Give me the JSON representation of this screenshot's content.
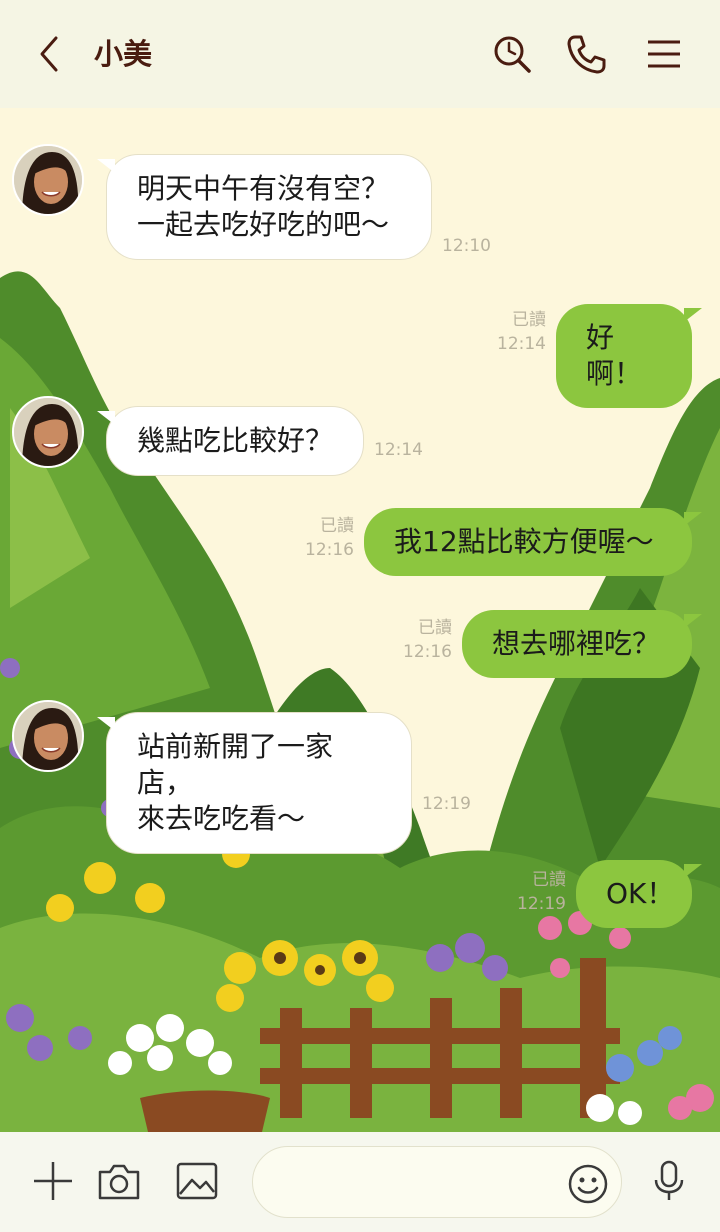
{
  "header": {
    "contact_name": "小美"
  },
  "colors": {
    "header_bg": "#f5f5e4",
    "chat_bg": "#fdf7dc",
    "outgoing_bubble": "#8cc63f",
    "incoming_bubble": "#ffffff",
    "accent_dark": "#4a1c10"
  },
  "icons": {
    "back": "chevron-left-icon",
    "search": "search-icon",
    "call": "phone-icon",
    "menu": "hamburger-menu-icon",
    "plus": "plus-icon",
    "camera": "camera-icon",
    "image": "image-icon",
    "emoji": "smiley-icon",
    "mic": "microphone-icon"
  },
  "messages": [
    {
      "direction": "in",
      "text": "明天中午有沒有空？\n一起去吃好吃的吧～",
      "time": "12:10"
    },
    {
      "direction": "out",
      "text": "好啊！",
      "read": "已讀",
      "time": "12:14"
    },
    {
      "direction": "in",
      "text": "幾點吃比較好？",
      "time": "12:14"
    },
    {
      "direction": "out",
      "text": "我12點比較方便喔～",
      "read": "已讀",
      "time": "12:16"
    },
    {
      "direction": "out",
      "text": "想去哪裡吃？",
      "read": "已讀",
      "time": "12:16"
    },
    {
      "direction": "in",
      "text": "站前新開了一家店，\n來去吃吃看～",
      "time": "12:19"
    },
    {
      "direction": "out",
      "text": "OK！",
      "read": "已讀",
      "time": "12:19"
    }
  ],
  "composer": {
    "placeholder": ""
  }
}
